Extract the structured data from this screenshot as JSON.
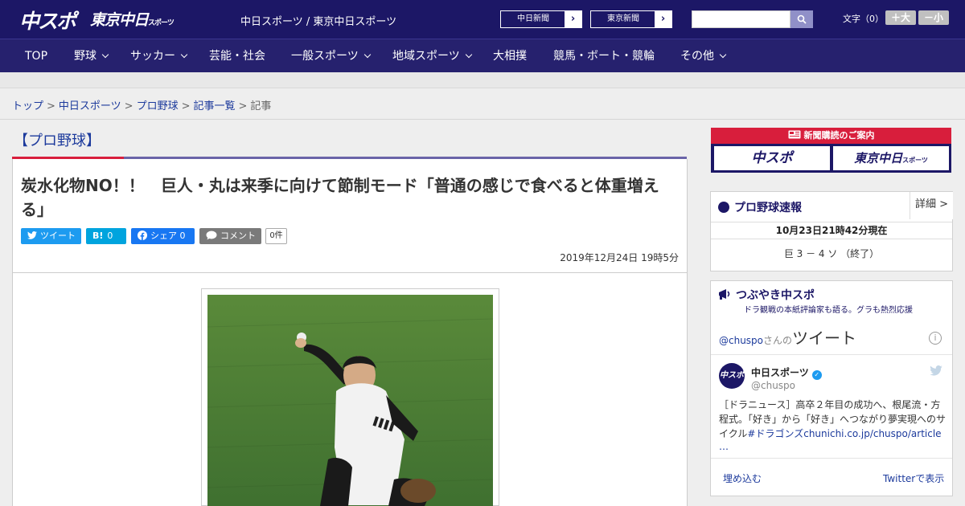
{
  "header": {
    "logo_chu": "中スポ",
    "logo_tokyo": "東京中日",
    "logo_tokyo_small": "スポーツ",
    "site_names": "中日スポーツ / 東京中日スポーツ",
    "paper_links": [
      "中日新聞",
      "東京新聞"
    ],
    "search": {
      "placeholder": ""
    },
    "font_size_label": "文字（0）",
    "font_plus": "＋大",
    "font_minus": "－小"
  },
  "nav": [
    {
      "label": "TOP"
    },
    {
      "label": "野球"
    },
    {
      "label": "サッカー"
    },
    {
      "label": "芸能・社会"
    },
    {
      "label": "一般スポーツ"
    },
    {
      "label": "地域スポーツ"
    },
    {
      "label": "大相撲"
    },
    {
      "label": "競馬・ボート・競輪"
    },
    {
      "label": "その他"
    }
  ],
  "breadcrumb": {
    "items": [
      "トップ",
      "中日スポーツ",
      "プロ野球",
      "記事一覧"
    ],
    "current": "記事",
    "separator": ">"
  },
  "article": {
    "category": "【プロ野球】",
    "headline": "炭水化物NO！！　巨人・丸は来季に向けて節制モード「普通の感じで食べると体重増える」",
    "share": {
      "tweet": "ツイート",
      "hatena_icon": "B!",
      "hatena_count": "0",
      "fb": "シェア 0",
      "comment": "コメント",
      "comment_count": "0件"
    },
    "date": "2019年12月24日 19時5分"
  },
  "sidebar": {
    "subscribe": {
      "title": "新聞購読のご案内",
      "logos": [
        "中スポ",
        "東京中日"
      ],
      "logo_small": "スポーツ"
    },
    "scores": {
      "title": "プロ野球速報",
      "detail": "詳細 >",
      "time": "10月23日21時42分現在",
      "result": "巨  3  －  4  ソ    （終了）"
    },
    "tweets": {
      "title": "つぶやき中スポ",
      "subtitle": "ドラ観戦の本紙評論家も語る。グラも熱烈応援",
      "handle_link": "@chuspo",
      "handle_suffix": "さんの",
      "tweet_word": "ツイート",
      "author_name": "中日スポーツ",
      "author_handle": "@chuspo",
      "avatar_text": "中スポ",
      "text_main": "［ドラニュース］高卒２年目の成功へ、根尾流・方程式。「好き」から「好き」へつながり夢実現へのサイクル",
      "text_link": "#ドラゴンズchunichi.co.jp/chuspo/article",
      "more": "…",
      "embed": "埋め込む",
      "view": "Twitterで表示"
    }
  },
  "colors": {
    "header_bg": "#1c1766",
    "nav_bg": "#26216e",
    "accent_red": "#d81e3c",
    "link_blue": "#1c3a9c",
    "twitter_blue": "#1d9bf0",
    "fb_blue": "#1877f2",
    "hatena_blue": "#00a4de",
    "comment_gray": "#7a7a7a"
  }
}
